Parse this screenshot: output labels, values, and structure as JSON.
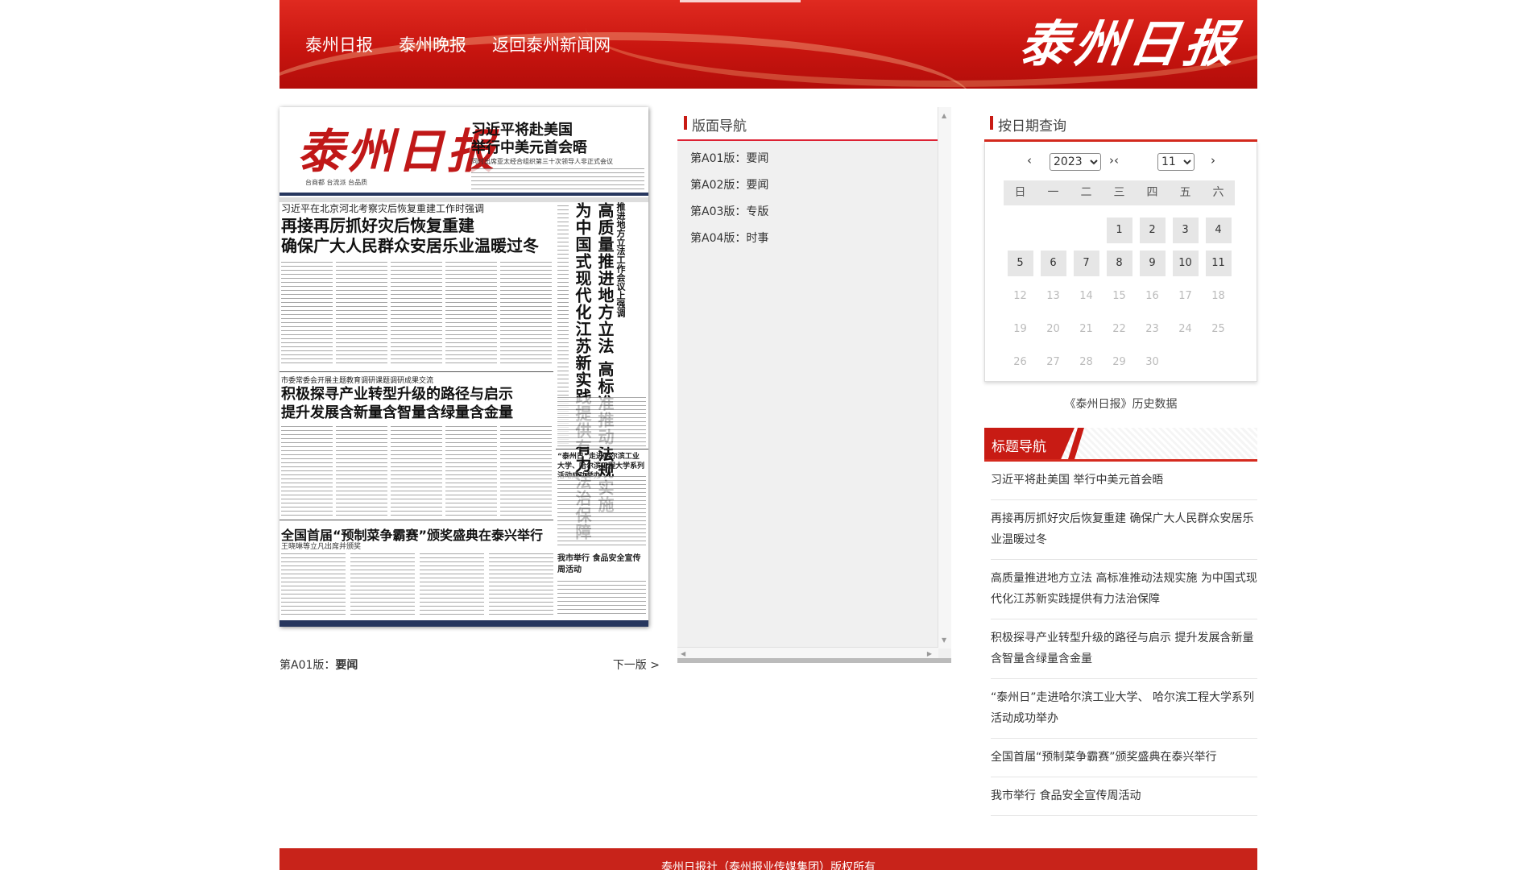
{
  "header": {
    "nav": [
      "泰州日报",
      "泰州晚报",
      "返回泰州新闻网"
    ],
    "brand": "泰州日报",
    "colors": {
      "primary_red": "#c8150f",
      "accent_red": "#d52a1e"
    }
  },
  "paper_image": {
    "masthead": "泰州日报",
    "slogan": "台商都 台流派 台品质",
    "top_headline": [
      "习近平将赴美国",
      "举行中美元首会晤"
    ],
    "top_sub": "同时出席亚太经合组织第三十次领导人非正式会议",
    "kicker1": "习近平在北京河北考察灾后恢复重建工作时强调",
    "lead_headline": [
      "再接再厉抓好灾后恢复重建",
      "确保广大人民群众安居乐业温暖过冬"
    ],
    "vertical_small": "推进地方立法工作会议上强调",
    "vertical_big1": "高质量推进地方立法 高标准推动法规实施",
    "vertical_big2": "为中国式现代化江苏新实践提供有力法治保障",
    "kicker2": "市委常委会开展主题教育调研课题调研成果交流",
    "second_headline": [
      "积极探寻产业转型升级的路径与启示",
      "提升发展含新量含智量含绿量含金量"
    ],
    "third_headline": "全国首届“预制菜争霸赛”颁奖盛典在泰兴举行",
    "third_sub": "王晓琳等立凡出席并颁奖",
    "side_item1": "“泰州日”走进哈尔滨工业大学、哈尔滨工程大学系列活动成功举办",
    "side_item2": "我市举行 食品安全宣传周活动"
  },
  "pager": {
    "current_prefix": "第A01版：",
    "current_name": "要闻",
    "next": "下一版 >"
  },
  "section_nav": {
    "title": "版面导航",
    "items": [
      "第A01版：要闻",
      "第A02版：要闻",
      "第A03版：专版",
      "第A04版：时事"
    ]
  },
  "date_query": {
    "title": "按日期查询",
    "prev_year": "‹",
    "prev_month": "›‹",
    "next_month": "›",
    "year": "2023",
    "month": "11",
    "weekdays": [
      "日",
      "一",
      "二",
      "三",
      "四",
      "五",
      "六"
    ],
    "first_weekday": 3,
    "days_in_month": 30,
    "last_available_day": 11,
    "history_link": "《泰州日报》历史数据"
  },
  "title_nav": {
    "title": "标题导航",
    "items": [
      "习近平将赴美国 举行中美元首会晤",
      "再接再厉抓好灾后恢复重建 确保广大人民群众安居乐业温暖过冬",
      "高质量推进地方立法 高标准推动法规实施 为中国式现代化江苏新实践提供有力法治保障",
      "积极探寻产业转型升级的路径与启示 提升发展含新量含智量含绿量含金量",
      "“泰州日”走进哈尔滨工业大学、 哈尔滨工程大学系列活动成功举办",
      "全国首届“预制菜争霸赛”颁奖盛典在泰兴举行",
      "我市举行 食品安全宣传周活动"
    ]
  },
  "footer": {
    "text": "泰州日报社（泰州报业传媒集团）版权所有"
  }
}
